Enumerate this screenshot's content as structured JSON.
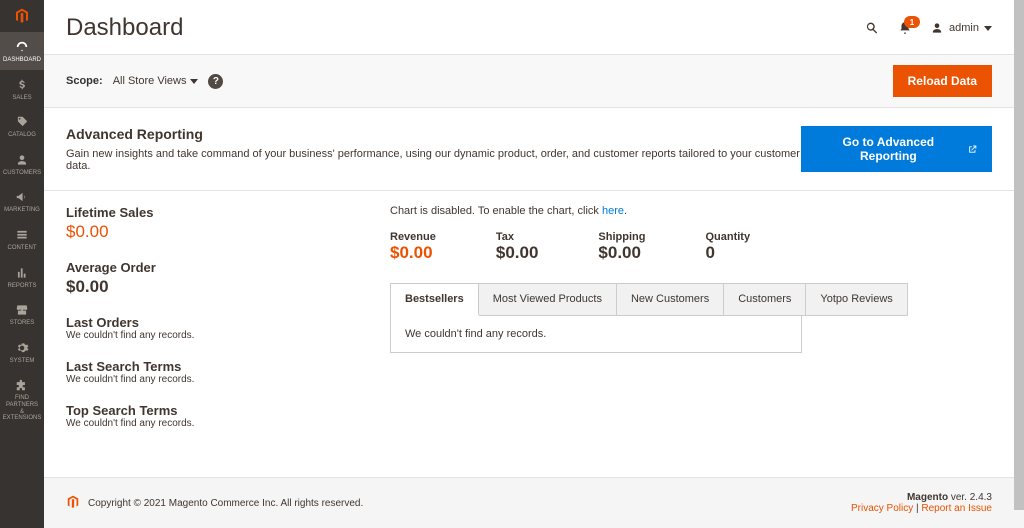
{
  "sidebar": {
    "items": [
      {
        "label": "DASHBOARD"
      },
      {
        "label": "SALES"
      },
      {
        "label": "CATALOG"
      },
      {
        "label": "CUSTOMERS"
      },
      {
        "label": "MARKETING"
      },
      {
        "label": "CONTENT"
      },
      {
        "label": "REPORTS"
      },
      {
        "label": "STORES"
      },
      {
        "label": "SYSTEM"
      },
      {
        "label": "FIND PARTNERS\n& EXTENSIONS"
      }
    ]
  },
  "header": {
    "title": "Dashboard",
    "notifications_count": "1",
    "user": "admin"
  },
  "scope": {
    "label": "Scope:",
    "value": "All Store Views",
    "reload_btn": "Reload Data"
  },
  "advanced": {
    "title": "Advanced Reporting",
    "desc": "Gain new insights and take command of your business' performance, using our dynamic product, order, and customer reports tailored to your customer data.",
    "btn": "Go to Advanced Reporting"
  },
  "left_stats": {
    "lifetime_label": "Lifetime Sales",
    "lifetime_val": "$0.00",
    "avg_label": "Average Order",
    "avg_val": "$0.00",
    "last_orders": "Last Orders",
    "last_orders_empty": "We couldn't find any records.",
    "last_search": "Last Search Terms",
    "last_search_empty": "We couldn't find any records.",
    "top_search": "Top Search Terms",
    "top_search_empty": "We couldn't find any records."
  },
  "right": {
    "chart_prefix": "Chart is disabled. To enable the chart, click ",
    "chart_link": "here",
    "chart_suffix": ".",
    "metrics": {
      "revenue_label": "Revenue",
      "revenue_val": "$0.00",
      "tax_label": "Tax",
      "tax_val": "$0.00",
      "shipping_label": "Shipping",
      "shipping_val": "$0.00",
      "quantity_label": "Quantity",
      "quantity_val": "0"
    },
    "tabs": [
      "Bestsellers",
      "Most Viewed Products",
      "New Customers",
      "Customers",
      "Yotpo Reviews"
    ],
    "tab_empty": "We couldn't find any records."
  },
  "footer": {
    "copyright": "Copyright © 2021 Magento Commerce Inc. All rights reserved.",
    "brand": "Magento",
    "ver_prefix": " ver. ",
    "version": "2.4.3",
    "privacy": "Privacy Policy",
    "sep": " | ",
    "report": "Report an Issue"
  }
}
